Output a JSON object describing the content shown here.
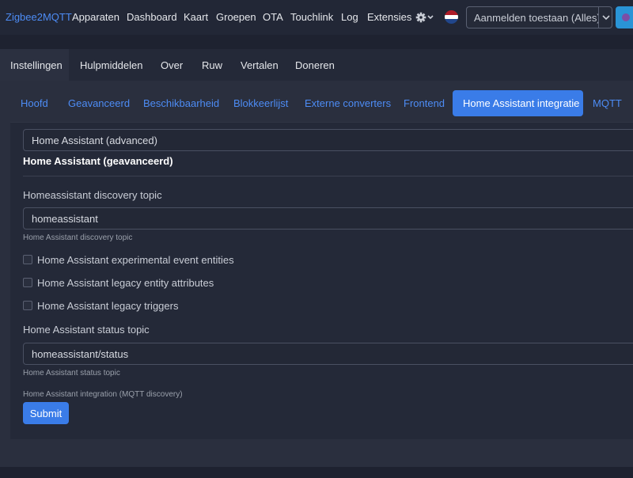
{
  "navbar": {
    "brand": "Zigbee2MQTT",
    "links": [
      "Apparaten",
      "Dashboard",
      "Kaart",
      "Groepen",
      "OTA",
      "Touchlink",
      "Log",
      "Extensies"
    ],
    "permit_join_label": "Aanmelden toestaan (Alles)"
  },
  "top_tabs": [
    "Instellingen",
    "Hulpmiddelen",
    "Over",
    "Ruw",
    "Vertalen",
    "Doneren"
  ],
  "sub_tabs": [
    "Hoofd",
    "Geavanceerd",
    "Beschikbaarheid",
    "Blokkeerlijst",
    "Externe converters",
    "Frontend",
    "Home Assistant integratie",
    "MQTT"
  ],
  "form": {
    "section_select": "Home Assistant (advanced)",
    "section_title": "Home Assistant (geavanceerd)",
    "discovery_topic_label": "Homeassistant discovery topic",
    "discovery_topic_value": "homeassistant",
    "discovery_topic_help": "Home Assistant discovery topic",
    "checkboxes": [
      "Home Assistant experimental event entities",
      "Home Assistant legacy entity attributes",
      "Home Assistant legacy triggers"
    ],
    "status_topic_label": "Home Assistant status topic",
    "status_topic_value": "homeassistant/status",
    "status_topic_help": "Home Assistant status topic",
    "integration_help": "Home Assistant integration (MQTT discovery)",
    "submit_label": "Submit"
  },
  "colors": {
    "accent": "#3a7ce8",
    "link": "#4d8cf5",
    "background": "#1e2230"
  },
  "icons": [
    "gear-icon",
    "chevron-down-icon",
    "netherlands-flag-icon"
  ]
}
